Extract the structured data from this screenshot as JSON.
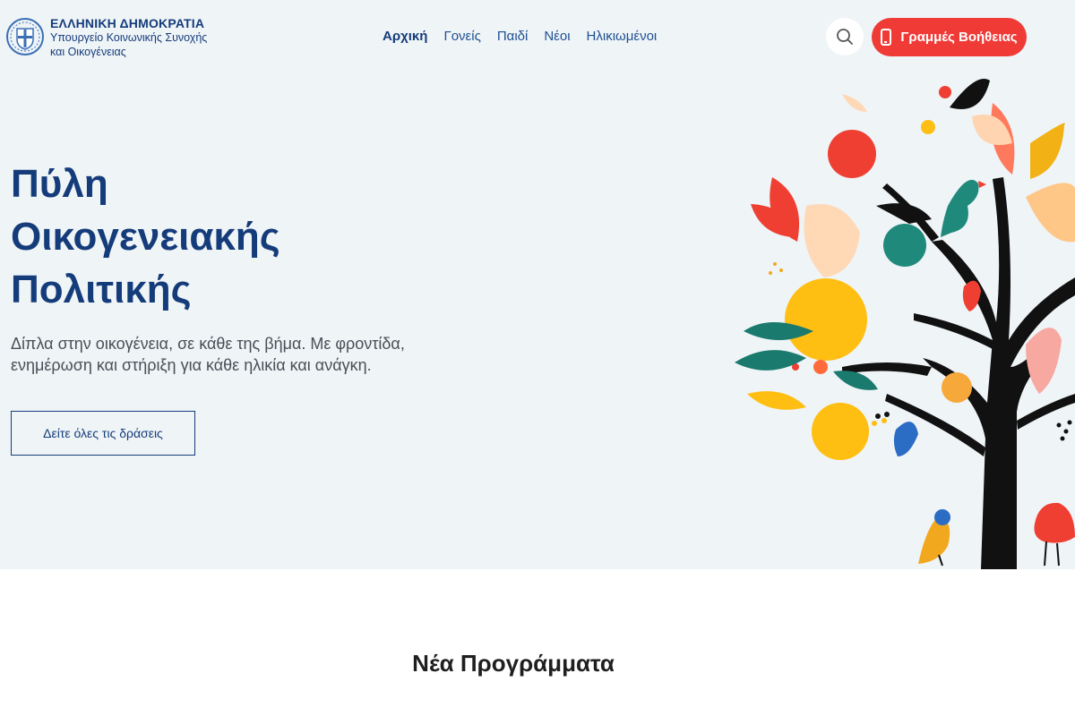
{
  "header": {
    "logo_title": "ΕΛΛΗΝΙΚΗ ΔΗΜΟΚΡΑΤΙΑ",
    "logo_sub_1": "Υπουργείο Κοινωνικής Συνοχής",
    "logo_sub_2": "και Οικογένειας",
    "nav": [
      "Αρχική",
      "Γονείς",
      "Παιδί",
      "Νέοι",
      "Ηλικιωμένοι"
    ],
    "active_nav": "Αρχική",
    "help_label": "Γραμμές Βοήθειας",
    "search_icon": "search-icon",
    "help_icon": "phone-icon"
  },
  "hero": {
    "title_line_1": "Πύλη",
    "title_line_2": "Οικογενειακής",
    "title_line_3": "Πολιτικής",
    "desc_line_1": "Δίπλα στην οικογένεια, σε κάθε της βήμα. Με φροντίδα,",
    "desc_line_2": "ενημέρωση και στήριξη για κάθε ηλικία και ανάγκη.",
    "cta_label": "Δείτε όλες τις δράσεις",
    "illustration": "tree-with-birds-illustration"
  },
  "programs": {
    "title": "Νέα Προγράμματα"
  },
  "colors": {
    "brand_blue": "#153c7a",
    "hero_bg": "#eff4f7",
    "help_red": "#ef3a36"
  }
}
